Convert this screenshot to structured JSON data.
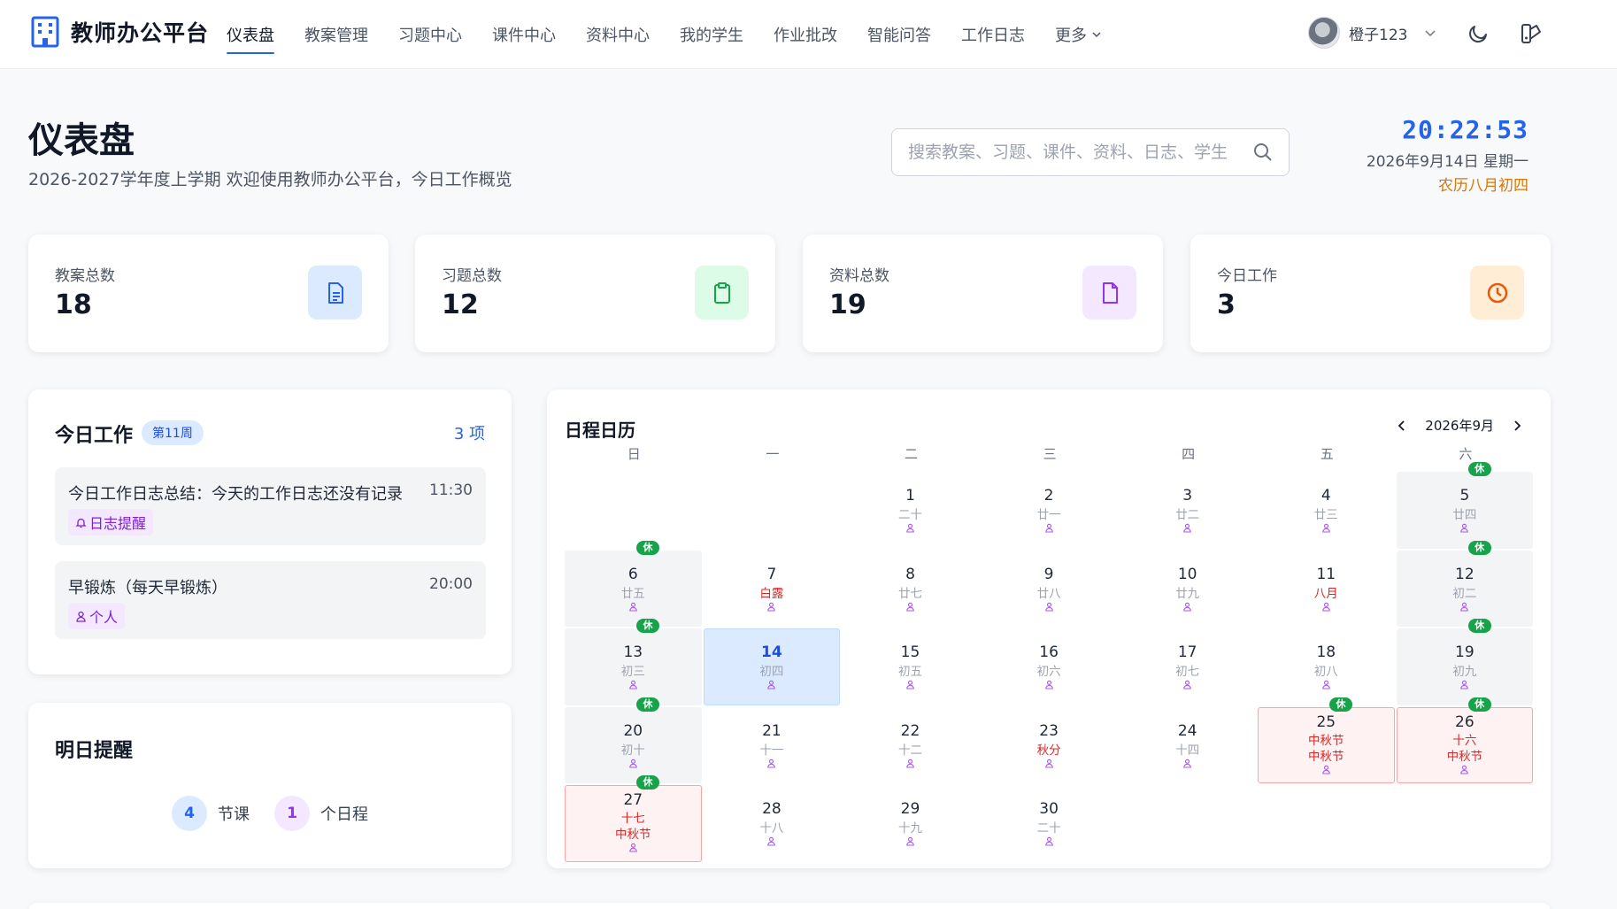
{
  "app": {
    "brand": "教师办公平台"
  },
  "nav": {
    "items": [
      {
        "label": "仪表盘",
        "active": true
      },
      {
        "label": "教案管理"
      },
      {
        "label": "习题中心"
      },
      {
        "label": "课件中心"
      },
      {
        "label": "资料中心"
      },
      {
        "label": "我的学生"
      },
      {
        "label": "作业批改"
      },
      {
        "label": "智能问答"
      },
      {
        "label": "工作日志"
      },
      {
        "label": "更多"
      }
    ]
  },
  "user": {
    "name": "橙子123"
  },
  "header": {
    "title": "仪表盘",
    "subtitle": "2026-2027学年度上学期 欢迎使用教师办公平台，今日工作概览",
    "search_placeholder": "搜索教案、习题、课件、资料、日志、学生",
    "time": "20:22:53",
    "date": "2026年9月14日 星期一",
    "lunar": "农历八月初四"
  },
  "stats": [
    {
      "label": "教案总数",
      "value": "18",
      "icon": "document-icon",
      "color": "#2563eb",
      "bg": "#dbeafe"
    },
    {
      "label": "习题总数",
      "value": "12",
      "icon": "clipboard-icon",
      "color": "#16a34a",
      "bg": "#dcfce7"
    },
    {
      "label": "资料总数",
      "value": "19",
      "icon": "file-icon",
      "color": "#9333ea",
      "bg": "#f3e8ff"
    },
    {
      "label": "今日工作",
      "value": "3",
      "icon": "clock-icon",
      "color": "#ea580c",
      "bg": "#ffedd5"
    }
  ],
  "today_work": {
    "title": "今日工作",
    "week_badge": "第11周",
    "count": "3 项",
    "tasks": [
      {
        "title": "今日工作日志总结：今天的工作日志还没有记录",
        "time": "11:30",
        "tag": "日志提醒",
        "tag_icon": "bell-icon"
      },
      {
        "title": "早锻炼（每天早锻炼）",
        "time": "20:00",
        "tag": "个人",
        "tag_icon": "person-icon"
      }
    ]
  },
  "tomorrow": {
    "title": "明日提醒",
    "items": [
      {
        "num": "4",
        "label": "节课",
        "color": "#2563eb",
        "bg": "#dbeafe"
      },
      {
        "num": "1",
        "label": "个日程",
        "color": "#9333ea",
        "bg": "#f3e8ff"
      }
    ]
  },
  "calendar": {
    "title": "日程日历",
    "month": "2026年9月",
    "weekdays": [
      "日",
      "一",
      "二",
      "三",
      "四",
      "五",
      "六"
    ],
    "rest_label": "休",
    "colors": {
      "person": "#a855f7",
      "rest": "#16a34a",
      "holiday": "#dc2626"
    },
    "days": [
      {
        "empty": true
      },
      {
        "empty": true
      },
      {
        "day": "1",
        "lunar": "二十"
      },
      {
        "day": "2",
        "lunar": "廿一"
      },
      {
        "day": "3",
        "lunar": "廿二"
      },
      {
        "day": "4",
        "lunar": "廿三"
      },
      {
        "day": "5",
        "lunar": "廿四",
        "rest": true
      },
      {
        "day": "6",
        "lunar": "廿五",
        "rest": true
      },
      {
        "day": "7",
        "lunar": "白露",
        "red": true
      },
      {
        "day": "8",
        "lunar": "廿七"
      },
      {
        "day": "9",
        "lunar": "廿八"
      },
      {
        "day": "10",
        "lunar": "廿九"
      },
      {
        "day": "11",
        "lunar": "八月",
        "red": true
      },
      {
        "day": "12",
        "lunar": "初二",
        "rest": true
      },
      {
        "day": "13",
        "lunar": "初三",
        "rest": true
      },
      {
        "day": "14",
        "lunar": "初四",
        "today": true
      },
      {
        "day": "15",
        "lunar": "初五"
      },
      {
        "day": "16",
        "lunar": "初六"
      },
      {
        "day": "17",
        "lunar": "初七"
      },
      {
        "day": "18",
        "lunar": "初八"
      },
      {
        "day": "19",
        "lunar": "初九",
        "rest": true
      },
      {
        "day": "20",
        "lunar": "初十",
        "rest": true
      },
      {
        "day": "21",
        "lunar": "十一"
      },
      {
        "day": "22",
        "lunar": "十二"
      },
      {
        "day": "23",
        "lunar": "秋分",
        "red": true
      },
      {
        "day": "24",
        "lunar": "十四"
      },
      {
        "day": "25",
        "lunar": "中秋节",
        "red": true,
        "festival": "中秋节",
        "holiday": true
      },
      {
        "day": "26",
        "lunar": "十六",
        "red": true,
        "festival": "中秋节",
        "holiday": true
      },
      {
        "day": "27",
        "lunar": "十七",
        "red": true,
        "festival": "中秋节",
        "holiday": true
      },
      {
        "day": "28",
        "lunar": "十八"
      },
      {
        "day": "29",
        "lunar": "十九"
      },
      {
        "day": "30",
        "lunar": "二十"
      }
    ]
  }
}
